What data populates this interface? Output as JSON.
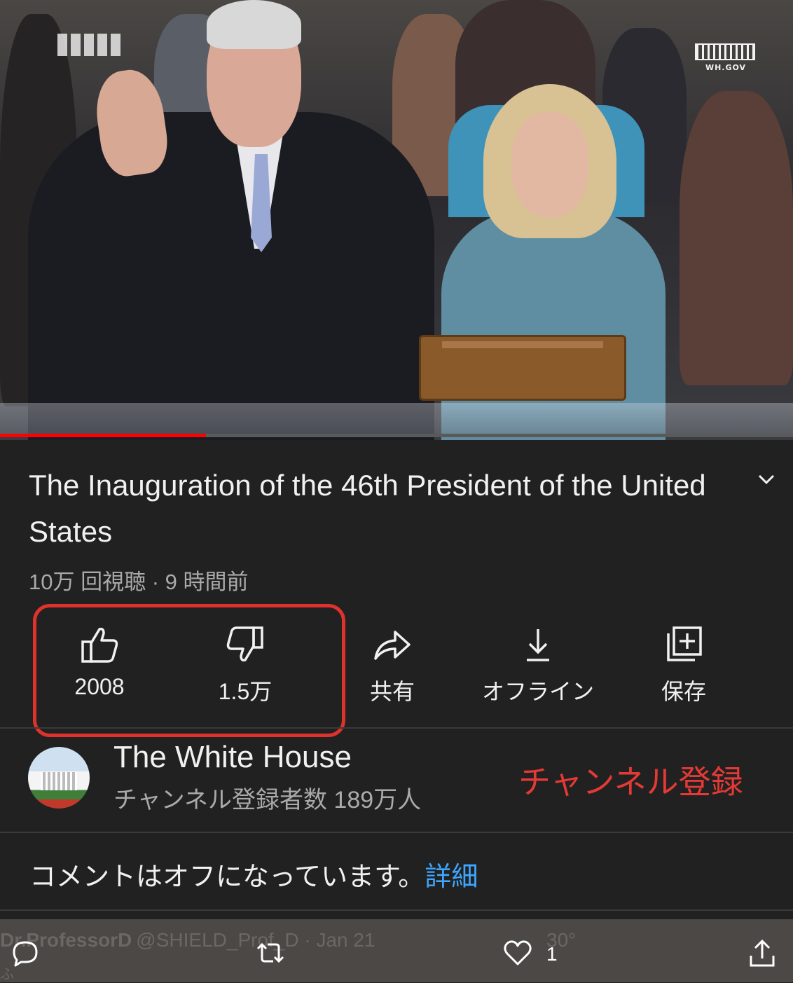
{
  "video": {
    "progress_fraction": 0.26,
    "logo_right_text": "WH.GOV"
  },
  "info": {
    "title": "The Inauguration of the 46th President of the United States",
    "meta": "10万 回視聴 · 9 時間前"
  },
  "actions": {
    "like_count": "2008",
    "dislike_count": "1.5万",
    "share_label": "共有",
    "offline_label": "オフライン",
    "save_label": "保存"
  },
  "channel": {
    "name": "The White House",
    "subscribers": "チャンネル登録者数 189万人",
    "subscribe_label": "チャンネル登録"
  },
  "comments": {
    "off_text": "コメントはオフになっています。",
    "details_label": "詳細"
  },
  "tweet": {
    "ghost_author": "Dr.ProfessorD",
    "ghost_handle": "@SHIELD_Prof_D · Jan 21",
    "ghost_temp": "30°",
    "ghost_line2": "ふ",
    "like_count": "1"
  },
  "colors": {
    "highlight": "#e0322c",
    "subscribe": "#e53935",
    "link": "#3ea6ff",
    "progress": "#ff0000"
  }
}
